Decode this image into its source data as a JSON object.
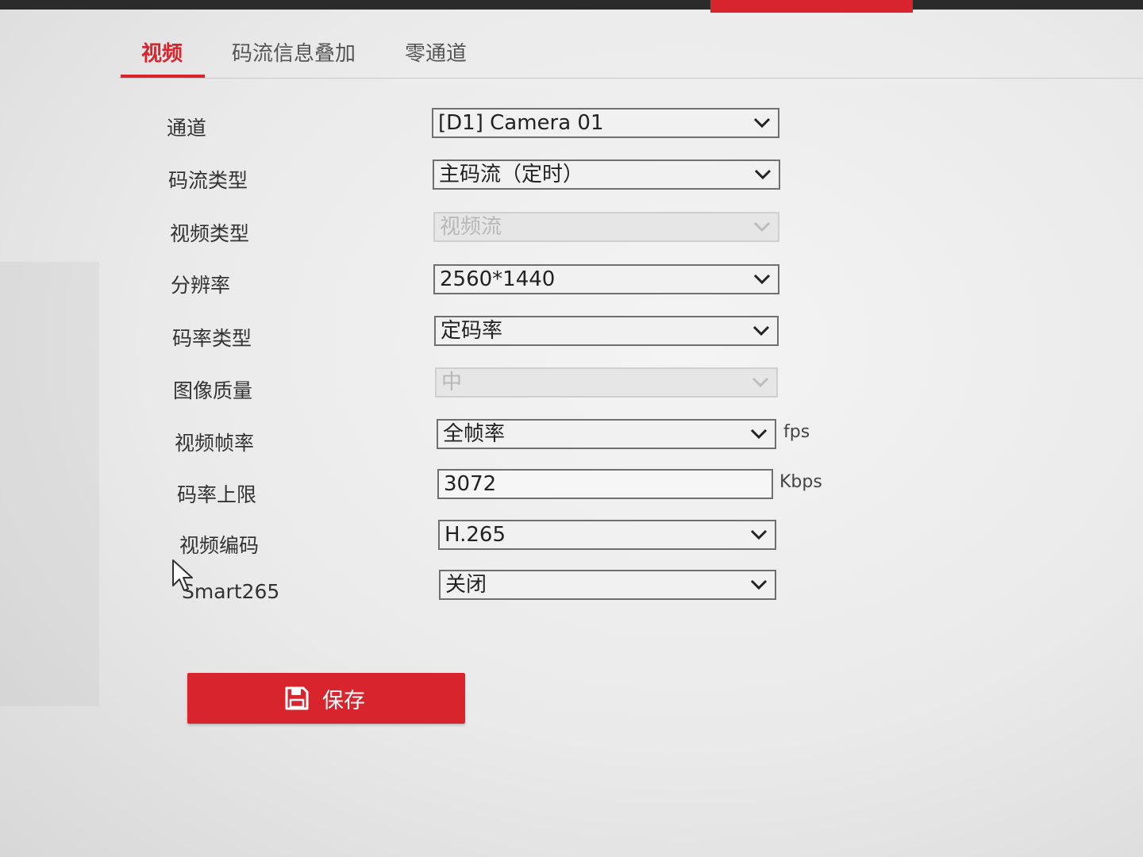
{
  "tabs": [
    {
      "label": "视频",
      "active": true
    },
    {
      "label": "码流信息叠加",
      "active": false
    },
    {
      "label": "零通道",
      "active": false
    }
  ],
  "form": {
    "channel": {
      "label": "通道",
      "value": "[D1] Camera 01"
    },
    "stream_type": {
      "label": "码流类型",
      "value": "主码流（定时）"
    },
    "video_type": {
      "label": "视频类型",
      "value": "视频流",
      "disabled": true
    },
    "resolution": {
      "label": "分辨率",
      "value": "2560*1440"
    },
    "bitrate_type": {
      "label": "码率类型",
      "value": "定码率"
    },
    "image_quality": {
      "label": "图像质量",
      "value": "中",
      "disabled": true
    },
    "frame_rate": {
      "label": "视频帧率",
      "value": "全帧率",
      "unit": "fps"
    },
    "max_bitrate": {
      "label": "码率上限",
      "value": "3072",
      "unit": "Kbps"
    },
    "video_encoding": {
      "label": "视频编码",
      "value": "H.265"
    },
    "smart265": {
      "label": "Smart265",
      "value": "关闭"
    }
  },
  "save_button": {
    "label": "保存"
  },
  "colors": {
    "accent": "#d8242d",
    "border": "#6f6f6f",
    "disabled": "#b8b8b8"
  },
  "icons": {
    "dropdown": "chevron-down-icon",
    "save": "save-icon",
    "pointer": "mouse-cursor-icon"
  }
}
